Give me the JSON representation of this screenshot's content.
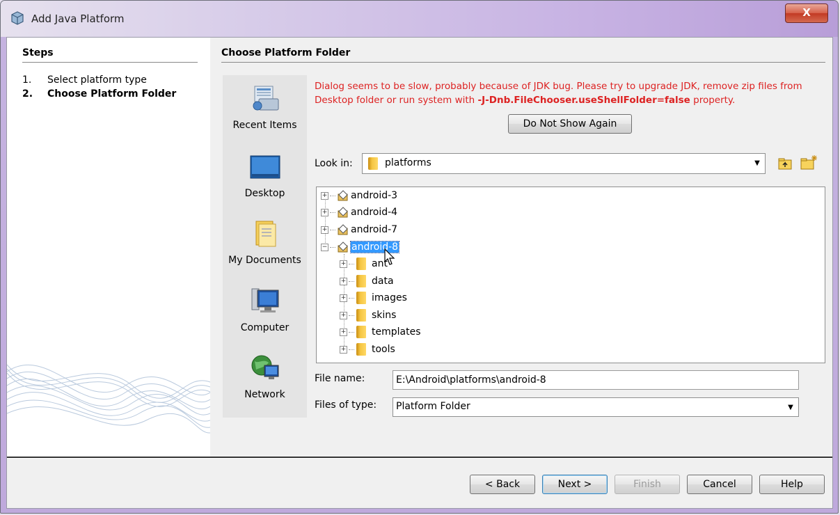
{
  "window": {
    "title": "Add Java Platform",
    "close_label": "X"
  },
  "steps": {
    "title": "Steps",
    "items": [
      {
        "num": "1.",
        "label": "Select platform type"
      },
      {
        "num": "2.",
        "label": "Choose Platform Folder"
      }
    ]
  },
  "content": {
    "title": "Choose Platform Folder"
  },
  "places": [
    {
      "label": "Recent Items",
      "icon": "recent-items-icon"
    },
    {
      "label": "Desktop",
      "icon": "desktop-icon"
    },
    {
      "label": "My Documents",
      "icon": "my-documents-icon"
    },
    {
      "label": "Computer",
      "icon": "computer-icon"
    },
    {
      "label": "Network",
      "icon": "network-icon"
    }
  ],
  "warning": {
    "text_before": "Dialog seems to be slow, probably because of JDK bug. Please try to upgrade JDK, remove zip files from Desktop folder or run system with ",
    "option": "-J-Dnb.FileChooser.useShellFolder=false",
    "text_after": " property."
  },
  "do_not_show_label": "Do Not Show Again",
  "look_in": {
    "label": "Look in:",
    "value": "platforms"
  },
  "tree": {
    "roots": [
      "android-3",
      "android-4",
      "android-7",
      "android-8"
    ],
    "selected": "android-8",
    "children": [
      "ant",
      "data",
      "images",
      "skins",
      "templates",
      "tools"
    ]
  },
  "file_name": {
    "label": "File name:",
    "value": "E:\\Android\\platforms\\android-8"
  },
  "files_of_type": {
    "label": "Files of type:",
    "value": "Platform Folder"
  },
  "buttons": {
    "back": "< Back",
    "next": "Next >",
    "finish": "Finish",
    "cancel": "Cancel",
    "help": "Help"
  },
  "colors": {
    "warning": "#dd2222",
    "selection": "#3399ff",
    "titlebar": "#c7b2e3"
  }
}
